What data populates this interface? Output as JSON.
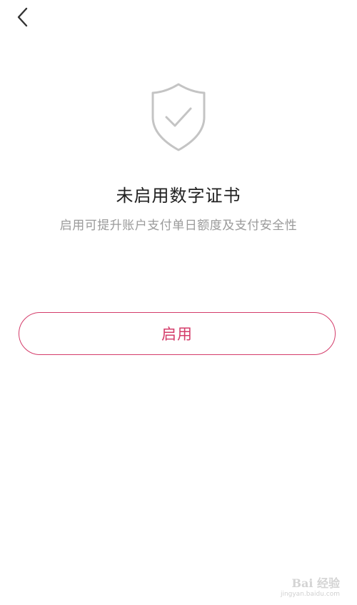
{
  "header": {
    "back_icon": "chevron-left-icon"
  },
  "status": {
    "icon": "shield-check-icon",
    "title": "未启用数字证书",
    "subtitle": "启用可提升账户支付单日额度及支付安全性"
  },
  "action": {
    "enable_label": "启用"
  },
  "watermark": {
    "logo_text": "Bai 经验",
    "url": "jingyan.baidu.com"
  },
  "colors": {
    "accent": "#d43c6a",
    "icon_gray": "#c4c4c4",
    "title": "#222222",
    "subtitle": "#9a9a9a"
  }
}
